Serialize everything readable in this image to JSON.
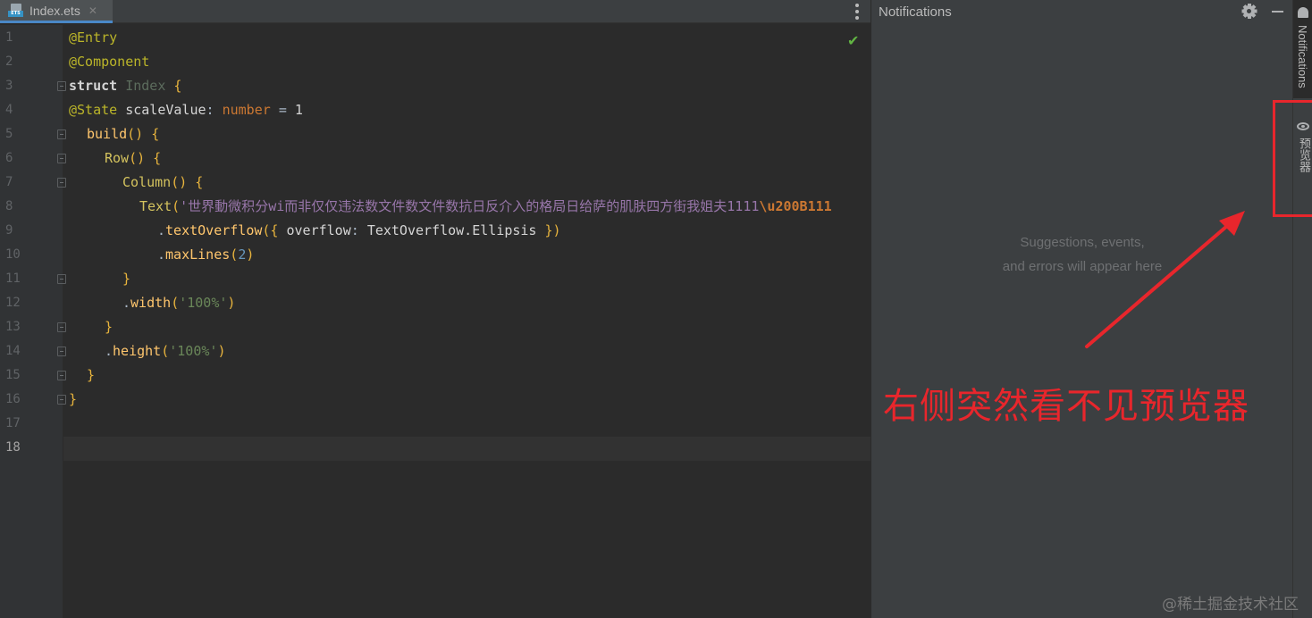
{
  "editor": {
    "tab_title": "Index.ets",
    "tab_close": "✕",
    "tab_badge": "ETS",
    "check_glyph": "✔",
    "line_numbers": [
      "1",
      "2",
      "3",
      "4",
      "5",
      "6",
      "7",
      "8",
      "9",
      "10",
      "11",
      "12",
      "13",
      "14",
      "15",
      "16",
      "17",
      "18"
    ],
    "code": {
      "l1_entry": "@Entry",
      "l2_component": "@Component",
      "l3_struct": "struct",
      "l3_name": "Index",
      "l3_brace": "{",
      "l4_state": "@State",
      "l4_var": "scaleValue",
      "l4_colon": ":",
      "l4_type": "number",
      "l4_eq": "=",
      "l4_val": "1",
      "l5_build": "build",
      "l5_rest": "() {",
      "l6_row": "Row",
      "l6_rest": "() {",
      "l7_column": "Column",
      "l7_rest": "() {",
      "l8_text": "Text",
      "l8_paren": "(",
      "l8_str": "'世界動微积分wi而非仅仅违法数文件数文件数抗日反介入的格局日给萨的肌肤四方街我姐夫1111",
      "l8_esc": "\\u200B111",
      "l9_dot": ".",
      "l9_method": "textOverflow",
      "l9_open": "({",
      "l9_key": "overflow",
      "l9_colon": ":",
      "l9_value": "TextOverflow.Ellipsis",
      "l9_close": "})",
      "l10_dot": ".",
      "l10_method": "maxLines",
      "l10_open": "(",
      "l10_val": "2",
      "l10_close": ")",
      "l11": "}",
      "l12_dot": ".",
      "l12_method": "width",
      "l12_open": "(",
      "l12_str": "'100%'",
      "l12_close": ")",
      "l13": "}",
      "l14_dot": ".",
      "l14_method": "height",
      "l14_open": "(",
      "l14_str": "'100%'",
      "l14_close": ")",
      "l15": "}",
      "l16": "}"
    }
  },
  "notifications": {
    "title": "Notifications",
    "empty_line1": "Suggestions, events,",
    "empty_line2": "and errors will appear here"
  },
  "tool_strip": {
    "notifications_tab": "Notifications",
    "previewer_tab": "预览器"
  },
  "annotation": {
    "text": "右侧突然看不见预览器",
    "color": "#e8262c"
  },
  "watermark": "@稀土掘金技术社区"
}
